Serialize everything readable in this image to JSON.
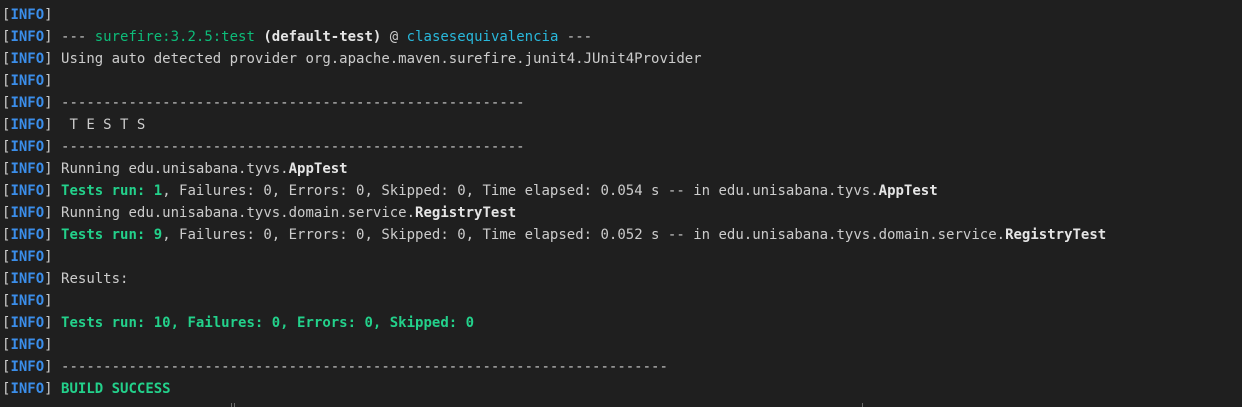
{
  "terminal": {
    "tag_open": "[",
    "tag_label": "INFO",
    "tag_close": "]",
    "lines": [
      [],
      [
        {
          "t": "--- ",
          "s": "plain"
        },
        {
          "t": "surefire:3.2.5:test",
          "s": "sf"
        },
        {
          "t": " ",
          "s": "plain"
        },
        {
          "t": "(default-test)",
          "s": "bold"
        },
        {
          "t": " @ ",
          "s": "plain"
        },
        {
          "t": "clasesequivalencia",
          "s": "cyan"
        },
        {
          "t": " ---",
          "s": "plain"
        }
      ],
      [
        {
          "t": "Using auto detected provider org.apache.maven.surefire.junit4.JUnit4Provider",
          "s": "plain"
        }
      ],
      [],
      [
        {
          "t": "-------------------------------------------------------",
          "s": "plain"
        }
      ],
      [
        {
          "t": " T E S T S",
          "s": "plain"
        }
      ],
      [
        {
          "t": "-------------------------------------------------------",
          "s": "plain"
        }
      ],
      [
        {
          "t": "Running edu.unisabana.tyvs.",
          "s": "plain"
        },
        {
          "t": "AppTest",
          "s": "bold"
        }
      ],
      [
        {
          "t": "Tests run: 1",
          "s": "green"
        },
        {
          "t": ", Failures: 0, Errors: 0, Skipped: 0, Time elapsed: 0.054 s -- in edu.unisabana.tyvs.",
          "s": "plain"
        },
        {
          "t": "AppTest",
          "s": "bold"
        }
      ],
      [
        {
          "t": "Running edu.unisabana.tyvs.domain.service.",
          "s": "plain"
        },
        {
          "t": "RegistryTest",
          "s": "bold"
        }
      ],
      [
        {
          "t": "Tests run: 9",
          "s": "green"
        },
        {
          "t": ", Failures: 0, Errors: 0, Skipped: 0, Time elapsed: 0.052 s -- in edu.unisabana.tyvs.domain.service.",
          "s": "plain"
        },
        {
          "t": "RegistryTest",
          "s": "bold"
        }
      ],
      [],
      [
        {
          "t": "Results:",
          "s": "plain"
        }
      ],
      [],
      [
        {
          "t": "Tests run: 10, Failures: 0, Errors: 0, Skipped: 0",
          "s": "green"
        }
      ],
      [],
      [
        {
          "t": "------------------------------------------------------------------------",
          "s": "plain"
        }
      ],
      [
        {
          "t": "BUILD SUCCESS",
          "s": "green"
        }
      ]
    ]
  },
  "colors": {
    "background": "#1f1f1f",
    "text": "#cccccc",
    "info_label": "#3b8eea",
    "success_green": "#23d18b",
    "plugin_green": "#0dbc79",
    "project_cyan": "#29b8db"
  }
}
